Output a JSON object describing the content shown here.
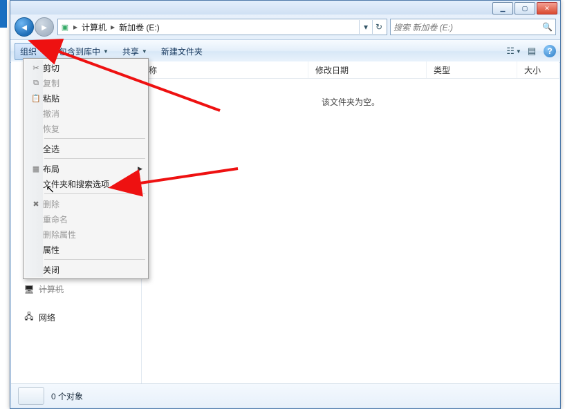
{
  "address": {
    "crumb1": "计算机",
    "crumb2": "新加卷 (E:)"
  },
  "search": {
    "placeholder": "搜索 新加卷 (E:)"
  },
  "toolbar": {
    "organize": "组织",
    "include": "包含到库中",
    "share": "共享",
    "newfolder": "新建文件夹"
  },
  "columns": {
    "name": "称",
    "modified": "修改日期",
    "type": "类型",
    "size": "大小"
  },
  "empty_message": "该文件夹为空。",
  "sidebar": {
    "computer": "计算机",
    "network": "网络"
  },
  "status": {
    "objects": "0 个对象"
  },
  "menu": {
    "cut": "剪切",
    "copy": "复制",
    "paste": "粘贴",
    "undo": "撤消",
    "redo": "恢复",
    "select_all": "全选",
    "layout": "布局",
    "folder_options": "文件夹和搜索选项",
    "delete": "删除",
    "rename": "重命名",
    "remove_props": "删除属性",
    "properties": "属性",
    "close": "关闭"
  }
}
